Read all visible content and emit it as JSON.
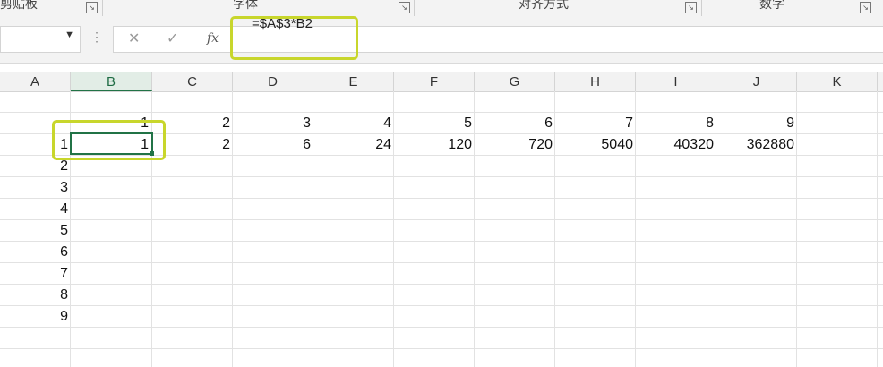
{
  "ribbon": {
    "groups": [
      {
        "label": "剪贴板"
      },
      {
        "label": "字体"
      },
      {
        "label": "对齐方式"
      },
      {
        "label": "数字"
      }
    ],
    "launcher_glyph": "↘"
  },
  "formula_bar": {
    "namebox_value": "",
    "namebox_dropdown": "▼",
    "dots": "⋮",
    "cancel_icon": "✕",
    "enter_icon": "✓",
    "fx_label": "fx",
    "formula": "=$A$3*B2"
  },
  "columns": [
    "A",
    "B",
    "C",
    "D",
    "E",
    "F",
    "G",
    "H",
    "I",
    "J",
    "K"
  ],
  "active_column": "B",
  "active_cell_value": "1",
  "row1": [
    "1",
    "2",
    "3",
    "4",
    "5",
    "6",
    "7",
    "8",
    "9"
  ],
  "row2": [
    "1",
    "2",
    "6",
    "24",
    "120",
    "720",
    "5040",
    "40320",
    "362880"
  ],
  "column_a_values": [
    "1",
    "2",
    "3",
    "4",
    "5",
    "6",
    "7",
    "8",
    "9"
  ],
  "colors": {
    "highlight": "#c8d62c",
    "selection": "#217346"
  }
}
